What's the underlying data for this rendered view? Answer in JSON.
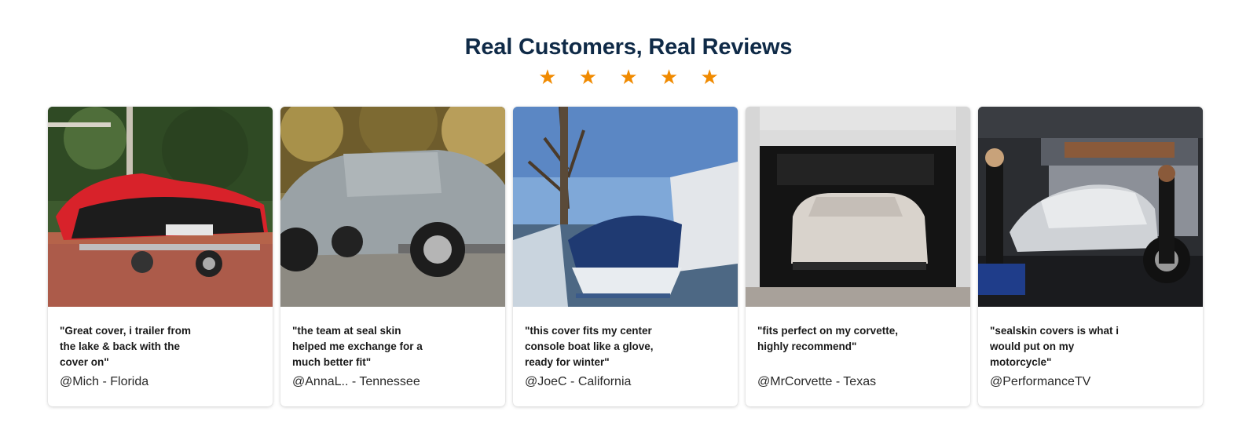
{
  "section": {
    "title": "Real Customers, Real Reviews",
    "stars": "★ ★ ★ ★ ★"
  },
  "reviews": [
    {
      "quote": "\"Great cover, i trailer from the lake & back with the cover on\"",
      "author": "@Mich - Florida",
      "image": "jet-ski-cover-photo"
    },
    {
      "quote": "\"the team at seal skin helped me exchange for a much better fit\"",
      "author": "@AnnaL.. - Tennessee",
      "image": "truck-cover-photo"
    },
    {
      "quote": "\"this cover fits my center console boat like a glove, ready for winter\"",
      "author": "@JoeC - California",
      "image": "boat-cover-photo"
    },
    {
      "quote": "\"fits perfect on my corvette, highly recommend\"",
      "author": "@MrCorvette - Texas",
      "image": "car-cover-photo"
    },
    {
      "quote": "\"sealskin covers is what i would put on my motorcycle\"",
      "author": "@PerformanceTV",
      "image": "motorcycle-cover-photo"
    }
  ]
}
